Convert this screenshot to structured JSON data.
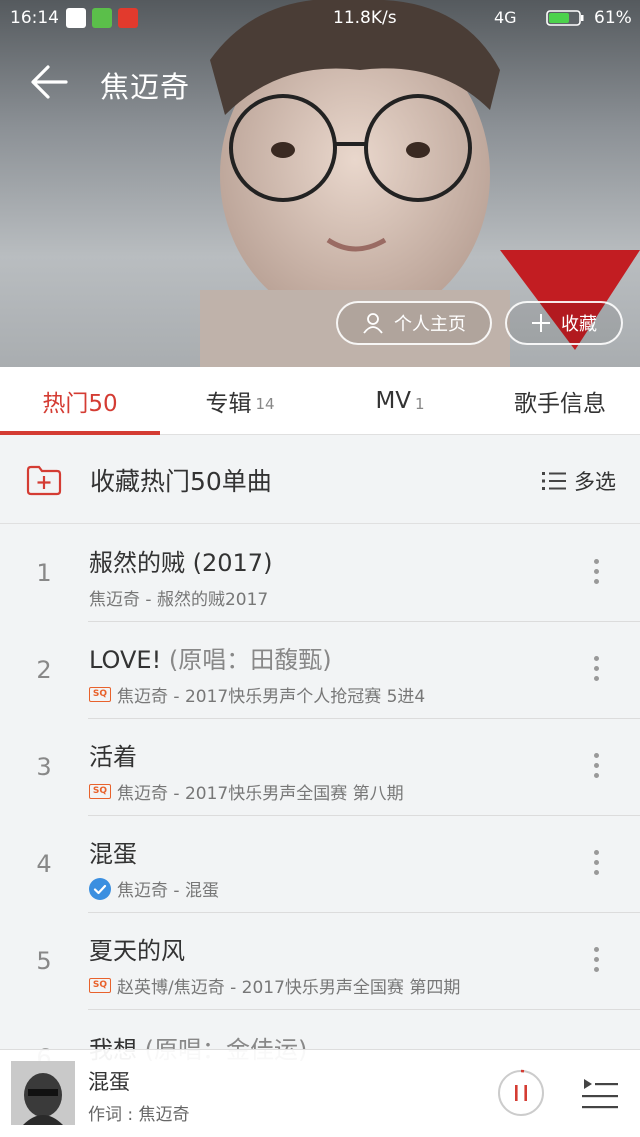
{
  "status_bar": {
    "time": "16:14",
    "speed": "11.8K/s",
    "network": "4G",
    "battery": "61%"
  },
  "header": {
    "title": "焦迈奇",
    "profile_label": "个人主页",
    "collect_label": "收藏"
  },
  "tabs": [
    {
      "label": "热门50",
      "count": ""
    },
    {
      "label": "专辑",
      "count": "14"
    },
    {
      "label": "MV",
      "count": "1"
    },
    {
      "label": "歌手信息",
      "count": ""
    }
  ],
  "collect_bar": {
    "label": "收藏热门50单曲",
    "multi_select": "多选"
  },
  "songs": [
    {
      "num": "1",
      "title": "赧然的贼 (2017)",
      "orig": "",
      "sub": "焦迈奇 - 赧然的贼2017",
      "badge": "none"
    },
    {
      "num": "2",
      "title": "LOVE!",
      "orig": "(原唱：田馥甄)",
      "sub": "焦迈奇 - 2017快乐男声个人抢冠赛 5进4",
      "badge": "sq"
    },
    {
      "num": "3",
      "title": "活着",
      "orig": "",
      "sub": "焦迈奇 - 2017快乐男声全国赛 第八期",
      "badge": "sq"
    },
    {
      "num": "4",
      "title": "混蛋",
      "orig": "",
      "sub": "焦迈奇 - 混蛋",
      "badge": "check"
    },
    {
      "num": "5",
      "title": "夏天的风",
      "orig": "",
      "sub": "赵英博/焦迈奇 - 2017快乐男声全国赛 第四期",
      "badge": "sq"
    },
    {
      "num": "6",
      "title": "我想",
      "orig": "(原唱：金佳运)",
      "sub": "",
      "badge": "none"
    }
  ],
  "badges": {
    "sq": "SQ"
  },
  "now_playing": {
    "title": "混蛋",
    "subtitle": "作词 : 焦迈奇"
  },
  "colors": {
    "accent": "#d43c33",
    "sq_badge": "#e8622c",
    "check": "#3b8fe0"
  }
}
